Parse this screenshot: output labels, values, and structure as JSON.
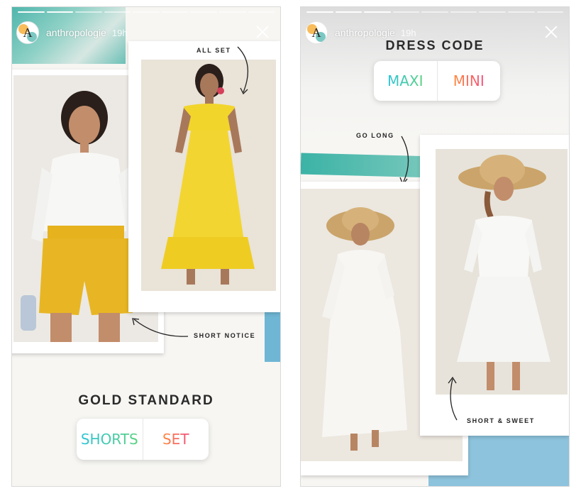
{
  "colors": {
    "gold": "#f0c52a",
    "teal": "#3bb3a6",
    "sky": "#7fbad6",
    "white": "#ffffff"
  },
  "stories": [
    {
      "username": "anthropologie",
      "time_ago": "19h",
      "avatar_letter": "A",
      "notes": {
        "top": "ALL SET",
        "bottom": "SHORT NOTICE"
      },
      "title": "GOLD STANDARD",
      "poll": {
        "option_a": "SHORTS",
        "option_b": "SET"
      }
    },
    {
      "username": "anthropologie",
      "time_ago": "19h",
      "avatar_letter": "A",
      "title": "DRESS CODE",
      "poll": {
        "option_a": "MAXI",
        "option_b": "MINI"
      },
      "notes": {
        "left": "GO LONG",
        "right": "SHORT & SWEET"
      }
    }
  ]
}
